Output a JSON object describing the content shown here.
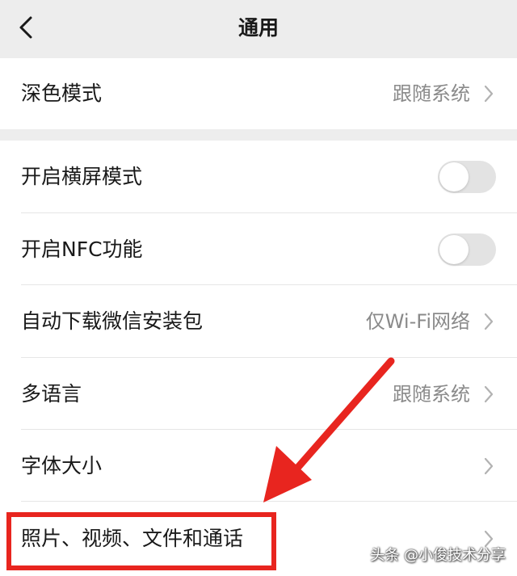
{
  "nav": {
    "title": "通用",
    "back_icon": "chevron-left-icon"
  },
  "groups": [
    {
      "rows": [
        {
          "label": "深色模式",
          "value": "跟随系统",
          "control": "chevron"
        }
      ]
    },
    {
      "rows": [
        {
          "label": "开启横屏模式",
          "control": "toggle",
          "on": false
        },
        {
          "label": "开启NFC功能",
          "control": "toggle",
          "on": false
        },
        {
          "label": "自动下载微信安装包",
          "value": "仅Wi-Fi网络",
          "control": "chevron"
        },
        {
          "label": "多语言",
          "value": "跟随系统",
          "control": "chevron"
        },
        {
          "label": "字体大小",
          "control": "chevron"
        },
        {
          "label": "照片、视频、文件和通话",
          "control": "chevron"
        }
      ]
    }
  ],
  "annotation": {
    "highlight_color": "#e8251f",
    "arrow_color": "#e8251f",
    "highlighted_item": "照片、视频、文件和通话"
  },
  "watermark": "头条 @小俊技术分享",
  "colors": {
    "background": "#ededed",
    "cell": "#ffffff",
    "text": "#191919",
    "secondary_text": "#8a8a8a",
    "toggle_off": "#e3e3e3"
  }
}
